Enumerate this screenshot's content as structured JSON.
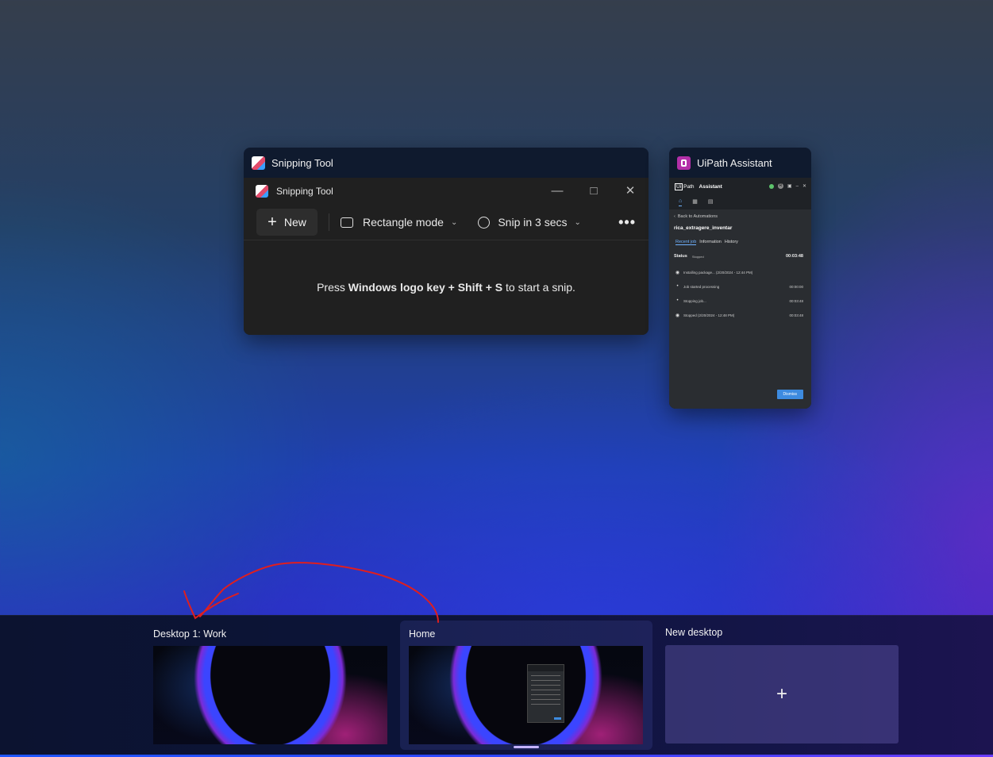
{
  "windows": {
    "snipping_tool": {
      "card_title": "Snipping Tool",
      "inner_title": "Snipping Tool",
      "new_label": "New",
      "mode_label": "Rectangle mode",
      "delay_label": "Snip in 3 secs",
      "more_label": "•••",
      "hint_prefix": "Press ",
      "hint_keys": "Windows logo key + Shift + S",
      "hint_suffix": " to start a snip.",
      "icon": "snipping-tool-icon"
    },
    "uipath": {
      "card_title": "UiPath Assistant",
      "logo_ui": "Ui",
      "logo_path": "Path",
      "logo_assistant": "Assistant",
      "back_label": "Back to Automations",
      "process_name": "rica_extragere_inventar",
      "tabs": [
        "Recent job",
        "Information",
        "History"
      ],
      "status_label": "Status",
      "status_value": "Stopped",
      "status_time": "00:03:48",
      "log_rows": [
        {
          "text": "Installing package... (2/20/2024 - 12:44 PM)",
          "time": ""
        },
        {
          "text": "Job started processing",
          "time": "00:00:00"
        },
        {
          "text": "Stopping job...",
          "time": "00:03:48"
        },
        {
          "text": "Stopped (2/20/2024 - 12:48 PM)",
          "time": "00:03:48"
        }
      ],
      "dismiss_label": "Dismiss",
      "icon": "uipath-icon"
    }
  },
  "desktops": [
    {
      "label": "Desktop 1: Work",
      "active": false
    },
    {
      "label": "Home",
      "active": true
    },
    {
      "label": "New desktop",
      "add_symbol": "+"
    }
  ],
  "colors": {
    "annotation": "#e01e1e",
    "accent": "#3d8be0",
    "active_indicator": "#c5b3ff"
  }
}
